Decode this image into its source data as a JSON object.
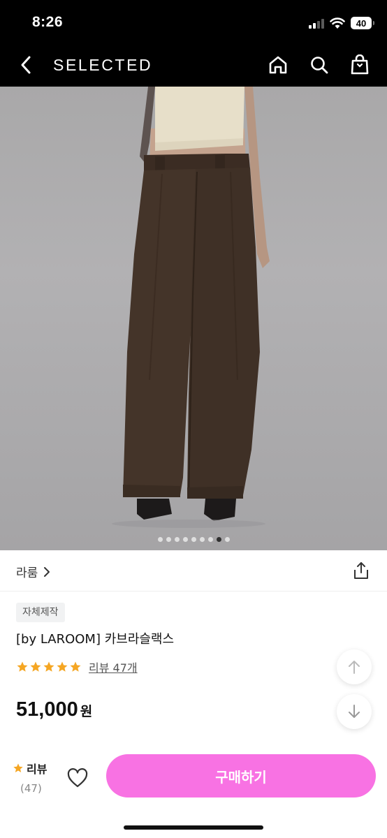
{
  "status": {
    "time": "8:26",
    "battery": "40"
  },
  "header": {
    "brand": "SELECTED",
    "icons": [
      "back-icon",
      "home-icon",
      "search-icon",
      "shopping-bag-icon"
    ]
  },
  "gallery": {
    "total_images": 9,
    "active_index": 7
  },
  "shop": {
    "name": "라룸"
  },
  "product": {
    "badge": "자체제작",
    "title": "[by LAROOM] 카브라슬랙스",
    "rating": 5,
    "review_link": "리뷰 47개",
    "price": "51,000",
    "price_unit": "원"
  },
  "bottom_bar": {
    "review_label": "리뷰",
    "review_count": "(47)",
    "buy_label": "구매하기"
  },
  "colors": {
    "accent": "#f872e3",
    "star": "#f5a623",
    "header_bg": "#000000"
  }
}
